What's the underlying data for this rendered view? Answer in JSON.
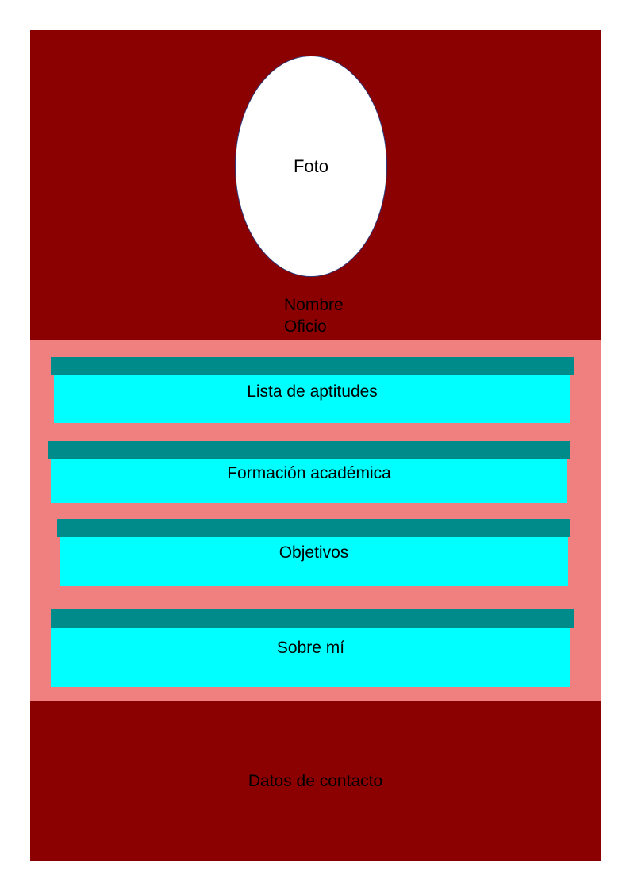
{
  "header": {
    "photo_label": "Foto",
    "name_label": "Nombre",
    "job_label": "Oficio"
  },
  "sections": [
    {
      "label": "Lista de aptitudes"
    },
    {
      "label": "Formación académica"
    },
    {
      "label": "Objetivos"
    },
    {
      "label": "Sobre mí"
    }
  ],
  "footer": {
    "contact_label": "Datos de contacto"
  },
  "colors": {
    "header_bg": "#8b0000",
    "middle_bg": "#f08080",
    "section_bar": "#008b8b",
    "section_box": "#00ffff",
    "photo_fill": "#ffffff"
  }
}
